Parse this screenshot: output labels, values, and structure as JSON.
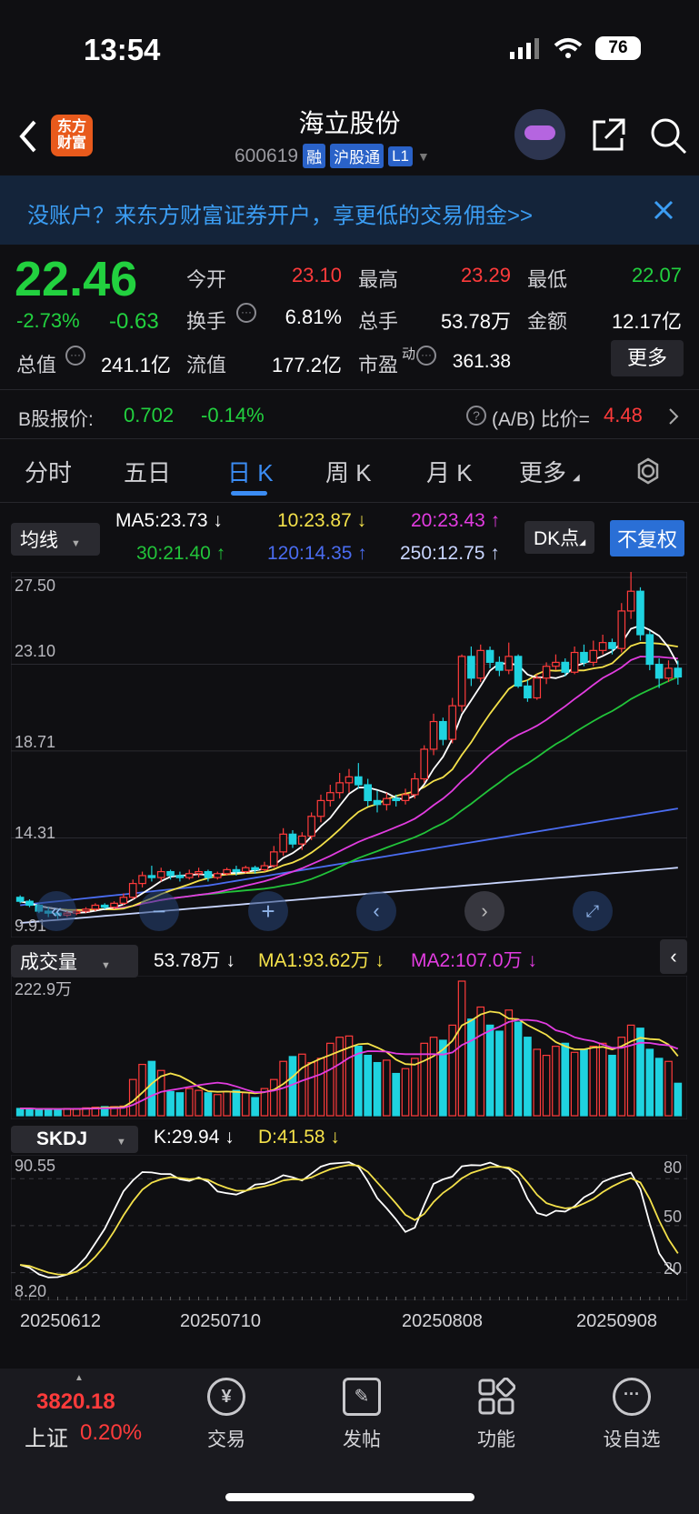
{
  "status": {
    "time": "13:54",
    "battery": "76"
  },
  "header": {
    "logo_line1": "东方",
    "logo_line2": "财富",
    "title": "海立股份",
    "code": "600619",
    "tags": [
      "融",
      "沪股通",
      "L1"
    ]
  },
  "banner": {
    "text": "没账户？来东方财富证券开户，享更低的交易佣金>>"
  },
  "quote": {
    "price": "22.46",
    "change_pct": "-2.73%",
    "change": "-0.63",
    "open_label": "今开",
    "open": "23.10",
    "high_label": "最高",
    "high": "23.29",
    "low_label": "最低",
    "low": "22.07",
    "turnover_label": "换手",
    "turnover": "6.81%",
    "volume_label": "总手",
    "volume": "53.78万",
    "amount_label": "金额",
    "amount": "12.17亿",
    "mktcap_label": "总值",
    "mktcap": "241.1亿",
    "float_label": "流值",
    "float": "177.2亿",
    "pe_label": "市盈",
    "pe_sup": "动",
    "pe": "361.38",
    "more": "更多"
  },
  "bshare": {
    "label": "B股报价:",
    "price": "0.702",
    "pct": "-0.14%",
    "ratio_label": "(A/B) 比价=",
    "ratio": "4.48"
  },
  "tabs": [
    "分时",
    "五日",
    "日 K",
    "周 K",
    "月 K",
    "更多"
  ],
  "ma_bar": {
    "selector": "均线",
    "ma5": "MA5:23.73 ↓",
    "ma10": "10:23.87 ↓",
    "ma20": "20:23.43 ↑",
    "ma30": "30:21.40 ↑",
    "ma120": "120:14.35 ↑",
    "ma250": "250:12.75 ↑",
    "dk": "DK点",
    "adjust": "不复权"
  },
  "price_axis": [
    "27.50",
    "23.10",
    "18.71",
    "14.31",
    "9.91"
  ],
  "volume_bar": {
    "selector": "成交量",
    "vol": "53.78万 ↓",
    "ma1": "MA1:93.62万 ↓",
    "ma2": "MA2:107.0万 ↓",
    "axis_top": "222.9万"
  },
  "skdj_bar": {
    "selector": "SKDJ",
    "k": "K:29.94 ↓",
    "d": "D:41.58 ↓",
    "axis_top": "90.55",
    "axis_bottom": "8.20",
    "levels": [
      "80",
      "50",
      "20"
    ]
  },
  "dates": [
    "20250612",
    "20250710",
    "20250808",
    "20250908"
  ],
  "index": {
    "value": "3820.18",
    "name": "上证",
    "pct": "0.20%"
  },
  "nav": [
    "交易",
    "发帖",
    "功能",
    "设自选"
  ],
  "colors": {
    "up": "#ff3b3b",
    "down": "#22d13f",
    "accent": "#3b8cf3",
    "cyan": "#1fd3e0"
  },
  "chart_data": {
    "type": "candlestick",
    "ylim": [
      9.91,
      27.5
    ],
    "candles": [
      [
        11.3,
        11.1,
        11.4,
        11.0
      ],
      [
        11.1,
        10.9,
        11.2,
        10.8
      ],
      [
        10.9,
        10.6,
        11.0,
        10.5
      ],
      [
        10.6,
        10.5,
        10.8,
        10.3
      ],
      [
        10.5,
        10.4,
        10.7,
        10.2
      ],
      [
        10.4,
        10.5,
        10.6,
        10.3
      ],
      [
        10.5,
        10.6,
        10.7,
        10.4
      ],
      [
        10.6,
        10.7,
        10.8,
        10.5
      ],
      [
        10.7,
        10.9,
        11.0,
        10.6
      ],
      [
        10.9,
        10.8,
        11.0,
        10.7
      ],
      [
        10.8,
        11.0,
        11.1,
        10.7
      ],
      [
        11.0,
        11.3,
        11.5,
        10.9
      ],
      [
        11.3,
        12.0,
        12.2,
        11.2
      ],
      [
        12.0,
        12.4,
        12.6,
        11.8
      ],
      [
        12.4,
        12.3,
        12.9,
        12.1
      ],
      [
        12.3,
        12.6,
        12.8,
        12.1
      ],
      [
        12.6,
        12.4,
        12.7,
        12.2
      ],
      [
        12.4,
        12.3,
        12.6,
        12.1
      ],
      [
        12.3,
        12.5,
        12.7,
        12.2
      ],
      [
        12.5,
        12.6,
        12.8,
        12.3
      ],
      [
        12.6,
        12.3,
        12.7,
        12.1
      ],
      [
        12.3,
        12.5,
        12.6,
        12.2
      ],
      [
        12.5,
        12.7,
        12.8,
        12.4
      ],
      [
        12.7,
        12.6,
        12.9,
        12.4
      ],
      [
        12.6,
        12.8,
        12.9,
        12.5
      ],
      [
        12.8,
        12.7,
        12.9,
        12.5
      ],
      [
        12.7,
        12.9,
        13.1,
        12.6
      ],
      [
        12.9,
        13.6,
        13.9,
        12.8
      ],
      [
        13.6,
        14.5,
        14.8,
        13.4
      ],
      [
        14.5,
        14.0,
        14.7,
        13.8
      ],
      [
        14.0,
        14.4,
        14.6,
        13.7
      ],
      [
        14.4,
        15.4,
        15.6,
        14.2
      ],
      [
        15.4,
        16.2,
        16.5,
        15.1
      ],
      [
        16.2,
        16.6,
        17.0,
        15.9
      ],
      [
        16.6,
        17.1,
        17.6,
        16.3
      ],
      [
        17.1,
        17.4,
        17.8,
        16.6
      ],
      [
        17.4,
        17.0,
        18.1,
        16.8
      ],
      [
        17.0,
        16.2,
        17.3,
        15.9
      ],
      [
        16.2,
        16.0,
        16.7,
        15.6
      ],
      [
        16.0,
        16.3,
        16.6,
        15.7
      ],
      [
        16.3,
        16.2,
        16.5,
        15.9
      ],
      [
        16.2,
        16.5,
        16.8,
        16.0
      ],
      [
        16.5,
        17.3,
        17.6,
        16.3
      ],
      [
        17.3,
        18.8,
        19.0,
        17.1
      ],
      [
        18.8,
        20.2,
        20.6,
        18.5
      ],
      [
        20.2,
        19.3,
        20.4,
        19.0
      ],
      [
        19.3,
        21.0,
        21.4,
        19.1
      ],
      [
        21.0,
        23.5,
        23.6,
        20.7
      ],
      [
        23.5,
        22.4,
        24.0,
        22.0
      ],
      [
        22.4,
        23.8,
        24.1,
        22.2
      ],
      [
        23.8,
        23.2,
        24.0,
        22.9
      ],
      [
        23.2,
        22.8,
        23.5,
        22.5
      ],
      [
        22.8,
        23.5,
        24.2,
        22.6
      ],
      [
        23.5,
        22.0,
        23.6,
        21.9
      ],
      [
        22.0,
        21.4,
        22.3,
        21.2
      ],
      [
        21.4,
        22.4,
        22.6,
        21.3
      ],
      [
        22.4,
        23.0,
        23.2,
        22.1
      ],
      [
        23.0,
        23.2,
        23.6,
        22.8
      ],
      [
        23.2,
        22.7,
        23.4,
        22.5
      ],
      [
        22.7,
        23.7,
        24.0,
        22.6
      ],
      [
        23.7,
        23.2,
        24.1,
        23.0
      ],
      [
        23.2,
        23.8,
        24.3,
        23.0
      ],
      [
        23.8,
        24.2,
        24.6,
        23.6
      ],
      [
        24.2,
        23.9,
        24.4,
        23.6
      ],
      [
        23.9,
        25.8,
        26.2,
        23.7
      ],
      [
        25.8,
        26.8,
        27.8,
        25.4
      ],
      [
        26.8,
        24.6,
        27.0,
        24.3
      ],
      [
        24.6,
        23.1,
        24.8,
        22.8
      ],
      [
        23.1,
        22.4,
        23.4,
        21.9
      ],
      [
        22.4,
        22.9,
        23.3,
        22.2
      ],
      [
        22.9,
        22.46,
        23.29,
        22.07
      ]
    ],
    "volume_max": 222.9,
    "volumes": [
      12,
      12,
      10,
      11,
      11,
      12,
      12,
      13,
      14,
      15,
      15,
      16,
      60,
      85,
      90,
      75,
      40,
      38,
      45,
      42,
      38,
      35,
      40,
      42,
      38,
      30,
      45,
      60,
      90,
      98,
      102,
      88,
      95,
      120,
      130,
      132,
      115,
      100,
      88,
      92,
      70,
      78,
      95,
      120,
      130,
      125,
      150,
      222.9,
      160,
      180,
      150,
      140,
      175,
      155,
      130,
      110,
      100,
      115,
      120,
      105,
      110,
      115,
      120,
      100,
      130,
      150,
      145,
      110,
      95,
      90,
      53.78
    ],
    "skdj_range": [
      8.2,
      90.55
    ]
  }
}
